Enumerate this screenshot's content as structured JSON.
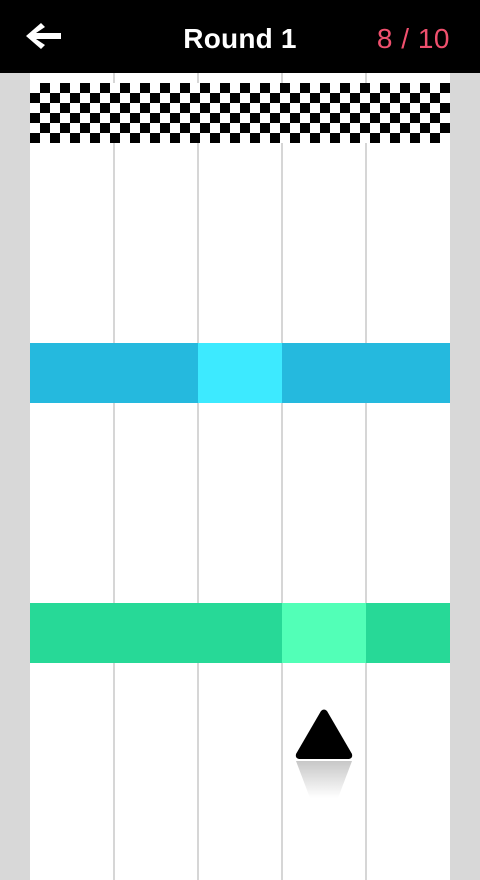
{
  "header": {
    "back_icon": "arrow-left-icon",
    "title": "Round 1",
    "progress_current": "8",
    "progress_separator": " / ",
    "progress_total": "10"
  },
  "colors": {
    "header_bg": "#000000",
    "counter": "#f0506e",
    "blue_bar": "#25b9de",
    "blue_gap": "#3deaff",
    "green_bar": "#27d997",
    "green_gap": "#52ffb7",
    "player": "#000000"
  },
  "game": {
    "lanes": 5,
    "player_lane": 4,
    "finish_line": "checkered",
    "bars": [
      {
        "name": "blue-bar",
        "color": "blue",
        "open_lane": 3
      },
      {
        "name": "green-bar",
        "color": "green",
        "open_lane": 4
      }
    ]
  }
}
